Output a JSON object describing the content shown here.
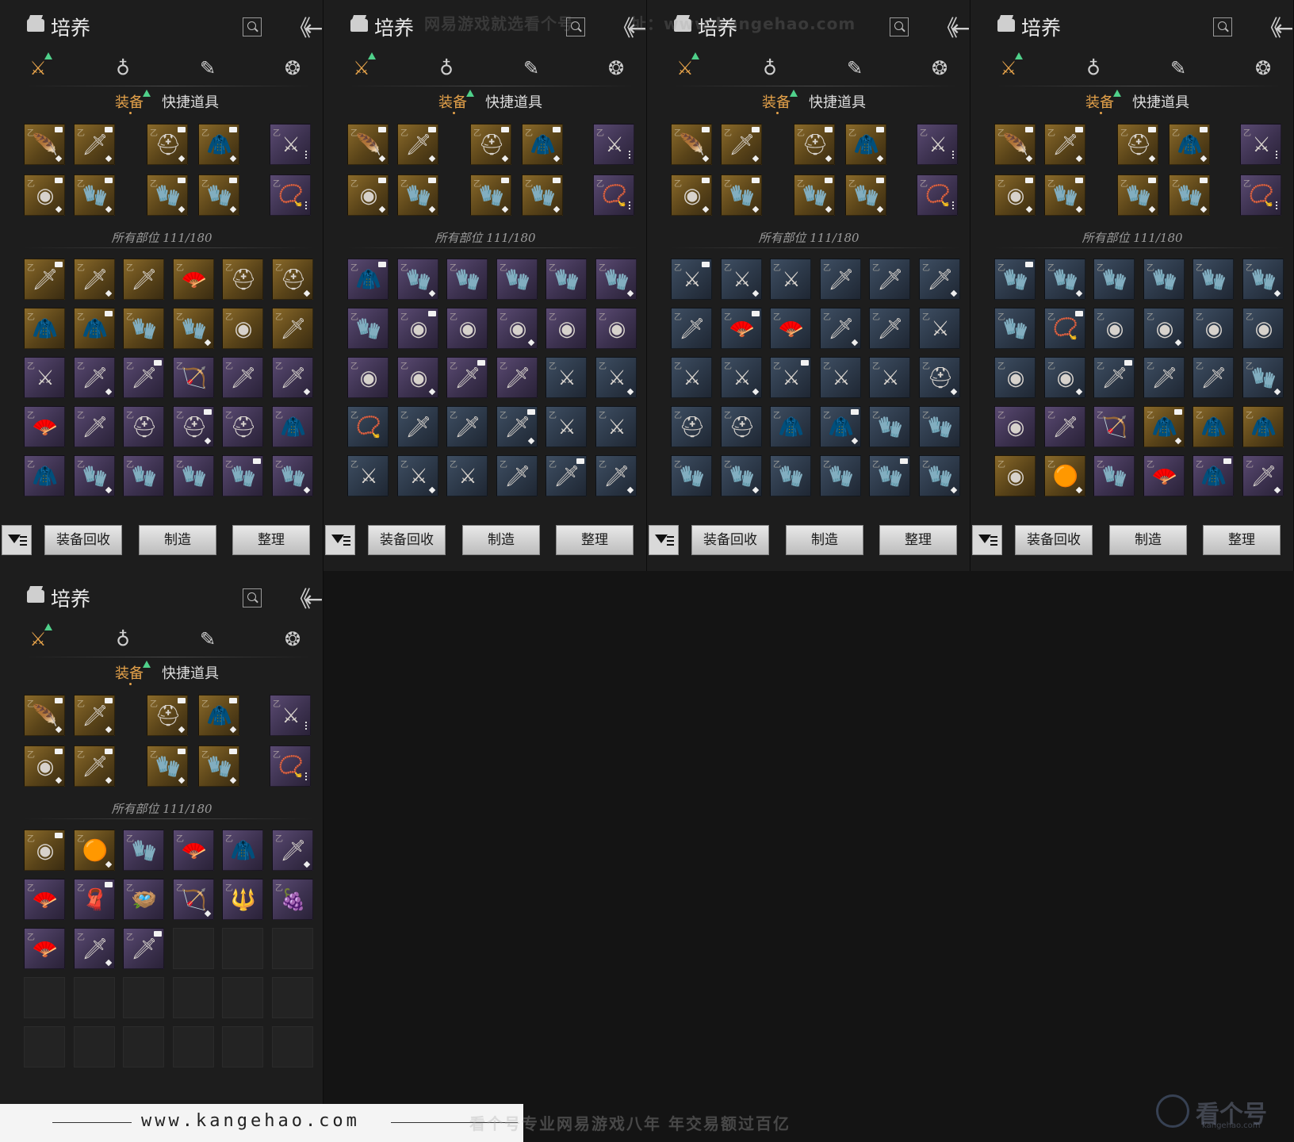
{
  "panel": {
    "title": "培养",
    "categories": [
      "weapon-icon",
      "pouch-icon",
      "scroll-icon",
      "token-icon"
    ],
    "tabs": {
      "equipment": "装备",
      "quick_items": "快捷道具"
    },
    "count_label": "所有部位 111/180",
    "buttons": {
      "recycle": "装备回收",
      "craft": "制造",
      "sort": "整理"
    }
  },
  "colors": {
    "accent": "#e5a24a",
    "gold": "#8a6a2a",
    "purple": "#5a4a72",
    "blue": "#3e4e62",
    "new_arrow": "#4fd08a"
  },
  "equipped": {
    "row1": [
      {
        "q": "gold",
        "icon": "🪶"
      },
      {
        "q": "gold",
        "icon": "🗡"
      },
      {
        "q": "gold",
        "icon": "⛑"
      },
      {
        "q": "gold",
        "icon": "🧥"
      },
      {
        "q": "purple",
        "icon": "⚔"
      }
    ],
    "row2": [
      {
        "q": "gold",
        "icon": "◉"
      },
      {
        "q": "gold",
        "icon": "🧤"
      },
      {
        "q": "gold",
        "icon": "🧤"
      },
      {
        "q": "gold",
        "icon": "🧤"
      },
      {
        "q": "purple",
        "icon": "📿"
      }
    ],
    "panel4_row2_second": {
      "q": "gold",
      "icon": "🗡"
    }
  },
  "grids": [
    [
      "gold:🗡",
      "gold:🗡",
      "gold:🗡",
      "gold:🪭",
      "gold:⛑",
      "gold:⛑",
      "gold:🧥",
      "gold:🧥",
      "gold:🧤",
      "gold:🧤",
      "gold:◉",
      "gold:🗡",
      "purple:⚔",
      "purple:🗡",
      "purple:🗡",
      "purple:🏹",
      "purple:🗡",
      "purple:🗡",
      "purple:🪭",
      "purple:🗡",
      "purple:⛑",
      "purple:⛑",
      "purple:⛑",
      "purple:🧥",
      "purple:🧥",
      "purple:🧤",
      "purple:🧤",
      "purple:🧤",
      "purple:🧤",
      "purple:🧤"
    ],
    [
      "purple:🧥",
      "purple:🧤",
      "purple:🧤",
      "purple:🧤",
      "purple:🧤",
      "purple:🧤",
      "purple:🧤",
      "purple:◉",
      "purple:◉",
      "purple:◉",
      "purple:◉",
      "purple:◉",
      "purple:◉",
      "purple:◉",
      "purple:🗡",
      "purple:🗡",
      "blue:⚔",
      "blue:⚔",
      "blue:📿",
      "blue:🗡",
      "blue:🗡",
      "blue:🗡",
      "blue:⚔",
      "blue:⚔",
      "blue:⚔",
      "blue:⚔",
      "blue:⚔",
      "blue:🗡",
      "blue:🗡",
      "blue:🗡"
    ],
    [
      "blue:⚔",
      "blue:⚔",
      "blue:⚔",
      "blue:🗡",
      "blue:🗡",
      "blue:🗡",
      "blue:🗡",
      "blue:🪭",
      "blue:🪭",
      "blue:🗡",
      "blue:🗡",
      "blue:⚔",
      "blue:⚔",
      "blue:⚔",
      "blue:⚔",
      "blue:⚔",
      "blue:⚔",
      "blue:⛑",
      "blue:⛑",
      "blue:⛑",
      "blue:🧥",
      "blue:🧥",
      "blue:🧤",
      "blue:🧤",
      "blue:🧤",
      "blue:🧤",
      "blue:🧤",
      "blue:🧤",
      "blue:🧤",
      "blue:🧤"
    ],
    [
      "blue:🧤",
      "blue:🧤",
      "blue:🧤",
      "blue:🧤",
      "blue:🧤",
      "blue:🧤",
      "blue:🧤",
      "blue:📿",
      "blue:◉",
      "blue:◉",
      "blue:◉",
      "blue:◉",
      "blue:◉",
      "blue:◉",
      "blue:🗡",
      "blue:🗡",
      "blue:🗡",
      "blue:🧤",
      "purple:◉",
      "purple:🗡",
      "purple:🏹",
      "gold:🧥",
      "gold:🧥",
      "gold:🧥",
      "gold:◉",
      "gold:🟠",
      "purple:🧤",
      "purple:🪭",
      "purple:🧥",
      "purple:🗡"
    ],
    [
      "gold:◉",
      "gold:🟠",
      "purple:🧤",
      "purple:🪭",
      "purple:🧥",
      "purple:🗡",
      "purple:🪭",
      "purple:🧣",
      "purple:🪺",
      "purple:🏹",
      "purple:🔱",
      "purple:🍇",
      "purple:🪭",
      "purple:🗡",
      "purple:🗡",
      "empty:",
      "empty:",
      "empty:",
      "empty:",
      "empty:",
      "empty:",
      "empty:",
      "empty:",
      "empty:",
      "empty:",
      "empty:",
      "empty:",
      "empty:",
      "empty:",
      "empty:"
    ]
  ],
  "watermarks": {
    "top_center": "网易游戏就选看个号",
    "top_url": "址：www.kangehao.com"
  },
  "footer": {
    "url": "www.kangehao.com",
    "slogan": "看个号专业网易游戏八年   年交易额过百亿",
    "logo": "看个号",
    "logo_sub": "kangehao.com"
  }
}
